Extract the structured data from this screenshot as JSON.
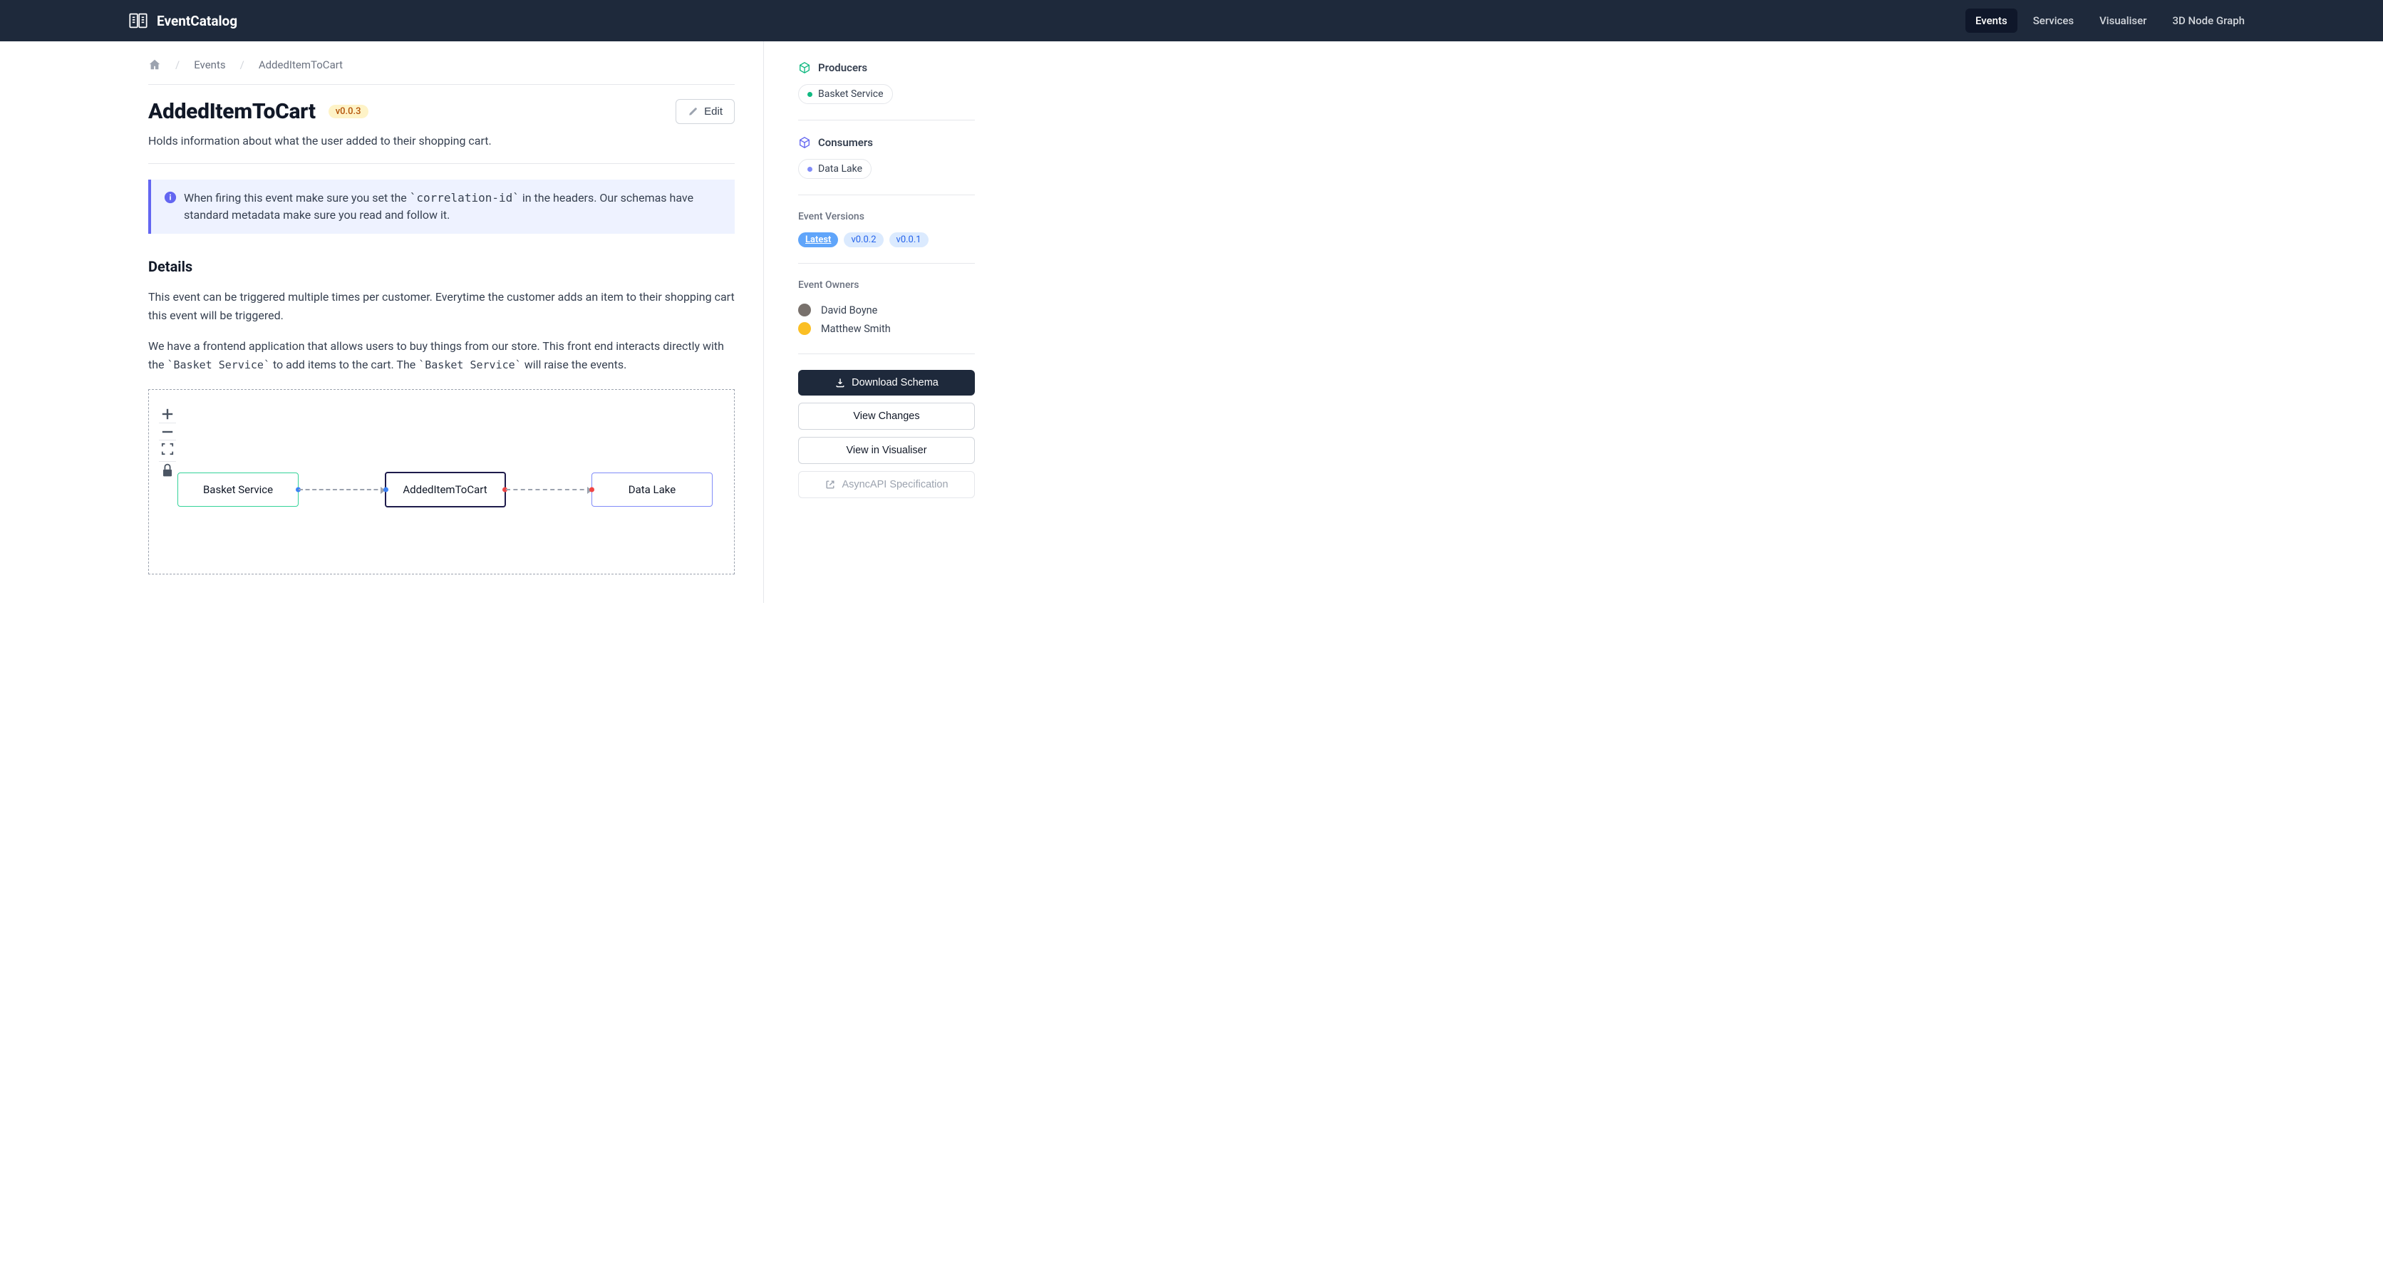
{
  "brand": "EventCatalog",
  "nav": {
    "items": [
      {
        "label": "Events",
        "active": true
      },
      {
        "label": "Services",
        "active": false
      },
      {
        "label": "Visualiser",
        "active": false
      },
      {
        "label": "3D Node Graph",
        "active": false
      }
    ]
  },
  "breadcrumb": {
    "items": [
      "Events",
      "AddedItemToCart"
    ]
  },
  "page": {
    "title": "AddedItemToCart",
    "version": "v0.0.3",
    "edit_label": "Edit",
    "subtitle": "Holds information about what the user added to their shopping cart."
  },
  "callout": {
    "text_before": "When firing this event make sure you set the ",
    "code": "`correlation-id`",
    "text_after": " in the headers. Our schemas have standard metadata make sure you read and follow it."
  },
  "details": {
    "heading": "Details",
    "p1": "This event can be triggered multiple times per customer. Everytime the customer adds an item to their shopping cart this event will be triggered.",
    "p2_before": "We have a frontend application that allows users to buy things from our store. This front end interacts directly with the ",
    "p2_code1": "`Basket Service`",
    "p2_mid": " to add items to the cart. The ",
    "p2_code2": "`Basket Service`",
    "p2_after": " will raise the events."
  },
  "diagram": {
    "producer": "Basket Service",
    "event": "AddedItemToCart",
    "consumer": "Data Lake"
  },
  "sidebar": {
    "producers": {
      "heading": "Producers",
      "items": [
        "Basket Service"
      ]
    },
    "consumers": {
      "heading": "Consumers",
      "items": [
        "Data Lake"
      ]
    },
    "versions": {
      "heading": "Event Versions",
      "items": [
        "Latest",
        "v0.0.2",
        "v0.0.1"
      ],
      "active": "Latest"
    },
    "owners": {
      "heading": "Event Owners",
      "items": [
        "David Boyne",
        "Matthew Smith"
      ]
    },
    "actions": {
      "download": "Download Schema",
      "changes": "View Changes",
      "visualiser": "View in Visualiser",
      "asyncapi": "AsyncAPI Specification"
    }
  }
}
